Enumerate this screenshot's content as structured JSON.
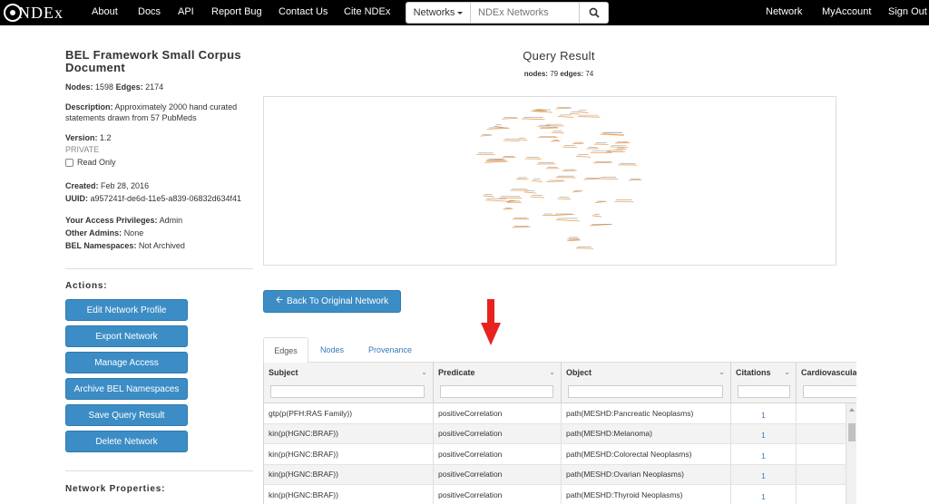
{
  "nav": {
    "brand": "NDEx",
    "links": [
      "About",
      "Docs",
      "API",
      "Report Bug",
      "Contact Us",
      "Cite NDEx"
    ],
    "search_scope": "Networks",
    "search_placeholder": "NDEx Networks",
    "right_links": [
      "Network",
      "MyAccount",
      "Sign Out"
    ]
  },
  "network": {
    "title": "BEL Framework Small Corpus Document",
    "nodes_label": "Nodes:",
    "nodes": "1598",
    "edges_label": "Edges:",
    "edges": "2174",
    "description_label": "Description:",
    "description": "Approximately 2000 hand curated statements drawn from 57 PubMeds",
    "version_label": "Version:",
    "version": "1.2",
    "visibility": "PRIVATE",
    "read_only_label": "Read Only",
    "created_label": "Created:",
    "created": "Feb 28, 2016",
    "uuid_label": "UUID:",
    "uuid": "a957241f-de6d-11e5-a839-06832d634f41",
    "privileges_label": "Your Access Privileges:",
    "privileges": "Admin",
    "other_admins_label": "Other Admins:",
    "other_admins": "None",
    "namespaces_label": "BEL Namespaces:",
    "namespaces": "Not Archived"
  },
  "actions": {
    "title": "Actions:",
    "buttons": [
      "Edit Network Profile",
      "Export Network",
      "Manage Access",
      "Archive BEL Namespaces",
      "Save Query Result",
      "Delete Network"
    ]
  },
  "properties_title": "Network Properties:",
  "query": {
    "title": "Query Result",
    "nodes_label": "nodes:",
    "nodes": "79",
    "edges_label": "edges:",
    "edges": "74",
    "back_button": "Back To Original Network"
  },
  "tabs": [
    "Edges",
    "Nodes",
    "Provenance"
  ],
  "table": {
    "columns": [
      "Subject",
      "Predicate",
      "Object",
      "Citations",
      "Cardiovascula"
    ],
    "rows": [
      [
        "gtp(p(PFH:RAS Family))",
        "positiveCorrelation",
        "path(MESHD:Pancreatic Neoplasms)",
        "1"
      ],
      [
        "kin(p(HGNC:BRAF))",
        "positiveCorrelation",
        "path(MESHD:Melanoma)",
        "1"
      ],
      [
        "kin(p(HGNC:BRAF))",
        "positiveCorrelation",
        "path(MESHD:Colorectal Neoplasms)",
        "1"
      ],
      [
        "kin(p(HGNC:BRAF))",
        "positiveCorrelation",
        "path(MESHD:Ovarian Neoplasms)",
        "1"
      ],
      [
        "kin(p(HGNC:BRAF))",
        "positiveCorrelation",
        "path(MESHD:Thyroid Neoplasms)",
        "1"
      ]
    ]
  },
  "colors": {
    "button_blue": "#3c8dc5",
    "link_blue": "#337ab7",
    "arrow_red": "#e8231f",
    "edge_orange": "#f0a050"
  }
}
